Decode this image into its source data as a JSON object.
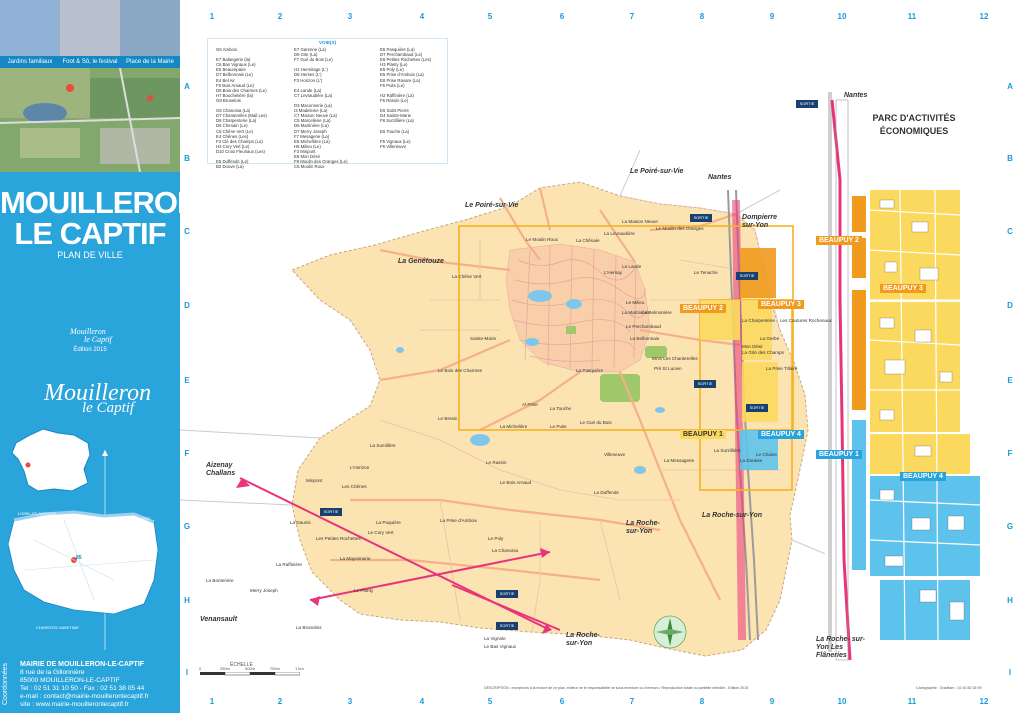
{
  "sidebar": {
    "photo_captions": [
      "Jardins familiaux",
      "Foot & Sô, le festival",
      "Place de la Mairie"
    ],
    "title_line1": "MOUILLERON",
    "title_line2": "LE CAPTIF",
    "subtitle": "PLAN DE VILLE",
    "small_logo_line1": "Mouilleron",
    "small_logo_line2": "le Captif",
    "edition": "Édition 2015",
    "logo_name": "Mouilleron",
    "logo_sub": "le Captif",
    "vendee_labels": [
      "LOIRE-ATLANTIQUE",
      "MAINE-ET-LOIRE",
      "DEUX-SÈVRES",
      "CHARENTE-MARITIME",
      "85"
    ],
    "contact": {
      "heading": "MAIRIE DE MOUILLERON-LE-CAPTIF",
      "address1": "8 rue de la Gillonnière",
      "address2": "85000 MOUILLERON-LE-CAPTIF",
      "phone": "Tel : 02 51 31 10 50 - Fax : 02 51 38 05 44",
      "email": "e-mail : contact@mairie-mouilleronlecaptif.fr",
      "site": "site : www.mairie-mouilleronlecaptif.fr",
      "vertical": "Coordonnées"
    }
  },
  "grid": {
    "columns": [
      "1",
      "2",
      "3",
      "4",
      "5",
      "6",
      "7",
      "8",
      "9",
      "10",
      "11",
      "12"
    ],
    "rows": [
      "A",
      "B",
      "C",
      "D",
      "E",
      "F",
      "G",
      "H",
      "I"
    ]
  },
  "index": {
    "heading": "VOIE(S)",
    "col1": [
      "G6 Amboix",
      "",
      "E7 Balangerie (la)",
      "C6 Bas Vignaux (Le)",
      "E5 Beaurepaire",
      "D7 Belbonnais (Le)",
      "E4 Bel Air",
      "F5 Bois Amaud (Le)",
      "D6 Bois des Charmes (Le)",
      "H7 Bouchetière (la)",
      "G8 Brunelois",
      "",
      "G5 Chanonia (La)",
      "D7 Chanterelles (Mail Les)",
      "D8 Charpenterie (La)",
      "D6 Chenain (Le)",
      "C5 Chêne Vert (Le)",
      "E4 Chênes (Les)",
      "F3 Clé des Champs (La)",
      "H2 Cory Vert (Le)",
      "D10 Croix Fleuriaux (Les)",
      "",
      "E5 Duffends (Le)",
      "B2 Douve (La)"
    ],
    "col2": [
      "E7 Garenne (La)",
      "D8 Gite (La)",
      "F7 Gué du Bois (Le)",
      "",
      "H1 Hermitage (L')",
      "D6 Herses (L')",
      "F3 Horizon (L')",
      "",
      "E4 Lande (La)",
      "C7 Levraudière (La)",
      "",
      "D3 Maconnerie (La)",
      "I3 Madeleine (La)",
      "C7 Maison Neuve (La)",
      "C5 Marcellerie (La)",
      "D6 Martinière (La)",
      "D7 Merry Joseph",
      "F7 Mesagerie (La)",
      "E5 Michellière (La)",
      "H5 Milieu (Le)",
      "F3 Minpont",
      "E8 Mon Désir",
      "F8 Moulin des Oranges (Le)",
      "C5 Moulin Roux"
    ],
    "col3": [
      "E5 Pasquière (La)",
      "D7 Perchambaud (Le)",
      "E6 Petites Rochettes (Les)",
      "H3 Planty (Le)",
      "E5 Poly (Le)",
      "E5 Prise d'Amboix (La)",
      "E8 Prise Ravare (La)",
      "F6 Puits (Le)",
      "",
      "H2 Raffinière (La)",
      "F6 Rassin (Le)",
      "",
      "E6 Saint Pierre",
      "D4 Sainte-Marie",
      "F8 Surzillière (La)",
      "",
      "E6 Touche (La)",
      "",
      "F5 Vignaux (Le)",
      "F6 Villeneuve"
    ]
  },
  "map": {
    "towns": {
      "poire_top": "Le Poiré-sur-Vie",
      "nantes_top": "Nantes",
      "poire_main": "Le Poiré-sur-Vie",
      "dompierre": "Dompierre sur-Yon",
      "genetouze": "La Genétouze",
      "aizenay": "Aizenay Challans",
      "roche_e": "La Roche-sur-Yon",
      "roche_main": "La Roche- sur-Yon",
      "venansault": "Venansault",
      "roche_bottom": "La Roche- sur-Yon",
      "roche_flaneries": "La Roche- sur-Yon Les Flâneries",
      "nantes_right": "Nantes"
    },
    "places": [
      "La Maison Neuve",
      "Le Moulin Roux",
      "La Chênaie",
      "La Levraudière",
      "Le Moulin des Oranges",
      "La Lande",
      "La Chêne Vert",
      "L'Hersay",
      "Le Tenache",
      "Le Milieu",
      "La Martinière",
      "La Belmonière",
      "Sainte-Marie",
      "Le Perchambaud",
      "La Belbonnais",
      "Mon Désir",
      "La Gité des Champs",
      "MAS Les Chanterelles",
      "La Pasquière",
      "Le Bois des Charmes",
      "Pré St Lucien",
      "La Prise Tillaire",
      "Al Prise",
      "La Touche",
      "Le Bresin",
      "La Michelière",
      "Le Gué du Bois",
      "Le Puits",
      "La Surzillière",
      "Le Rassin",
      "La Messagerie",
      "Villeneuve",
      "L'Horizon",
      "Minpont",
      "Les Chênes",
      "Le Bois Arnaud",
      "La Duffends",
      "La Daunis",
      "La Poquière",
      "La Prise d'Amboix",
      "Le Cory Vert",
      "Les Petites Rochettes",
      "Le Poly",
      "La Chanonia",
      "La Raffinière",
      "La Mayonnerie",
      "La Bonterière",
      "Le Planty",
      "Merry Joseph",
      "La Brunelois",
      "La Vignole",
      "Le Bas Vignaux",
      "Le Chaine",
      "La Doraise",
      "La Charpenterie",
      "Les Coutures Rochenaux",
      "La Gerbe",
      "La Sumillère"
    ],
    "zones": [
      "BEAUPUY 1",
      "BEAUPUY 2",
      "BEAUPUY 3",
      "BEAUPUY 4",
      "BEAUPUY 2",
      "BEAUPUY 3",
      "BEAUPUY 1",
      "BEAUPUY 4"
    ],
    "parc_title": "PARC D'ACTIVITÉS ÉCONOMIQUES",
    "exit_label": "SORTIE"
  },
  "footer": {
    "echelle": "ÉCHELLE",
    "scale_ticks": [
      "0",
      "250m",
      "500m",
      "750m",
      "1 km"
    ],
    "copyright": "DESCRIPTION : exceptions à la lecture de ce plan, éditeur ne le responsabilité ne sous eventuer ou d'erreurs / Reproduction totale ou partielle interdite - Edition 2015",
    "cartographie": "Cartographie : Gravitam - 02 40 82 36 99"
  },
  "colors": {
    "sidebar_blue": "#2aa5dc",
    "land": "#fce3b2",
    "zone_orange": "#f09a1e",
    "zone_yellow": "#fbd85e",
    "zone_blue": "#5ec3ec",
    "road_pink": "#e8347a",
    "water": "#7fc6ea",
    "green": "#9fc86a"
  }
}
